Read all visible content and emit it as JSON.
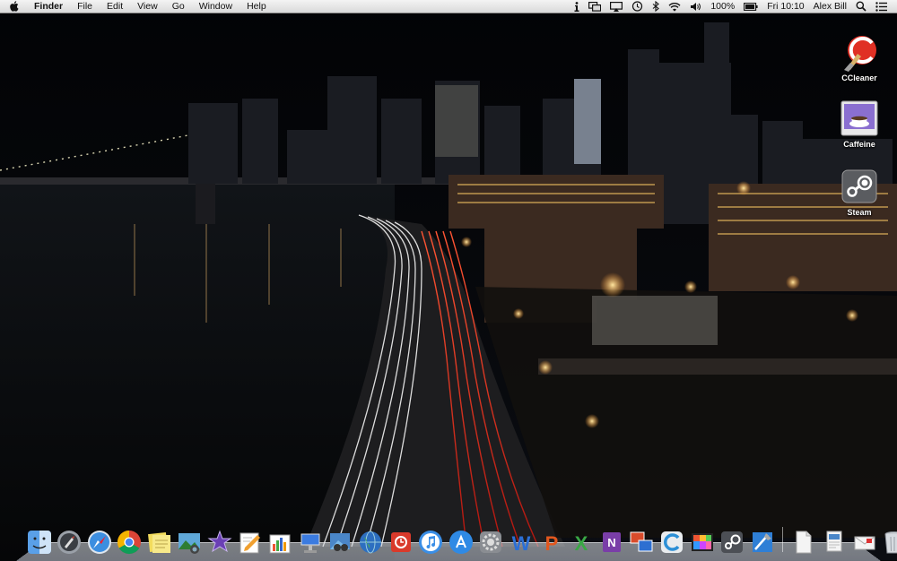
{
  "menubar": {
    "app_name": "Finder",
    "menus": [
      "File",
      "Edit",
      "View",
      "Go",
      "Window",
      "Help"
    ],
    "battery": "100%",
    "clock": "Fri 10:10",
    "user": "Alex Bill"
  },
  "desktop_icons": [
    {
      "label": "CCleaner",
      "icon": "ccleaner-icon"
    },
    {
      "label": "Caffeine",
      "icon": "caffeine-icon"
    },
    {
      "label": "Steam",
      "icon": "steam-icon"
    }
  ],
  "dock": {
    "apps": [
      "finder",
      "launchpad",
      "safari",
      "chrome",
      "stickies",
      "iphoto",
      "imovie",
      "pages",
      "numbers",
      "keynote",
      "preview",
      "network",
      "photobooth",
      "itunes",
      "app-store",
      "system-preferences",
      "word",
      "powerpoint",
      "excel",
      "onenote",
      "remote-desktop",
      "ccleaner",
      "final-cut",
      "steam",
      "xcode"
    ],
    "stacks": [
      "document",
      "downloads",
      "mail-stack",
      "trash"
    ]
  }
}
